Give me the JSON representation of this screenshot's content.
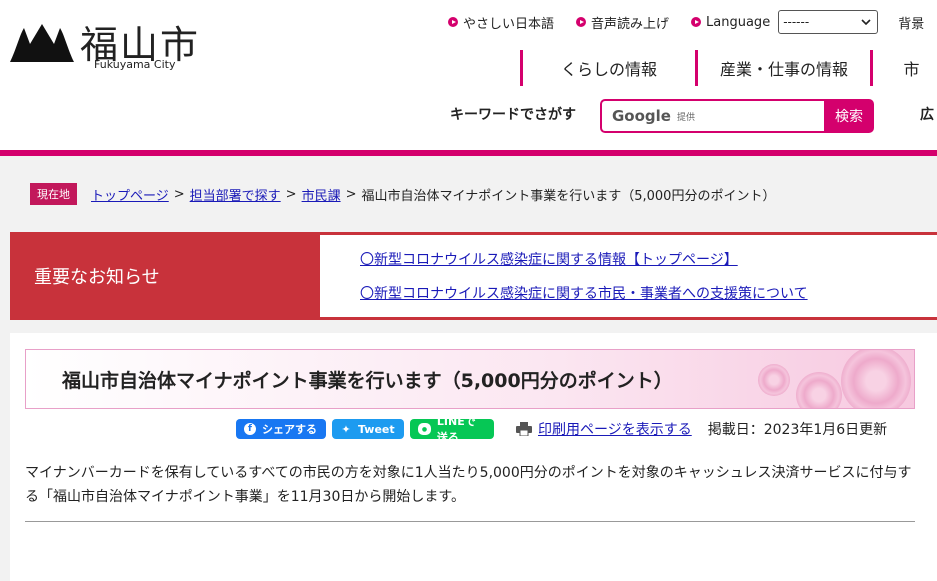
{
  "header": {
    "logo_kanji": "福山市",
    "logo_sub": "Fukuyama City",
    "util": [
      {
        "label": "やさしい日本語"
      },
      {
        "label": "音声読み上げ"
      },
      {
        "label": "Language"
      }
    ],
    "language_select_value": "------",
    "util_cut": "背景",
    "gnav": [
      "くらしの情報",
      "産業・仕事の情報",
      "市"
    ],
    "keyword_label": "キーワードでさがす",
    "search_brand": "Google",
    "search_brand_sub": "提供",
    "search_button": "検索",
    "cut_right": "広"
  },
  "breadcrumb": {
    "here": "現在地",
    "links": [
      "トップページ",
      "担当部署で探す",
      "市民課"
    ],
    "current": "福山市自治体マイナポイント事業を行います（5,000円分のポイント）",
    "separator": ">"
  },
  "notice": {
    "heading": "重要なお知らせ",
    "links": [
      "〇新型コロナウイルス感染症に関する情報【トップページ】",
      "〇新型コロナウイルス感染症に関する市民・事業者への支援策について"
    ]
  },
  "article": {
    "title": "福山市自治体マイナポイント事業を行います（5,000円分のポイント）",
    "share": {
      "facebook": "シェアする",
      "twitter": "Tweet",
      "line": "LINEで送る"
    },
    "print_link": "印刷用ページを表示する",
    "posted": "掲載日：2023年1月6日更新",
    "body": "マイナンバーカードを保有しているすべての市民の方を対象に1人当たり5,000円分のポイントを対象のキャッシュレス決済サービスに付与する「福山市自治体マイナポイント事業」を11月30日から開始します。"
  },
  "colors": {
    "brand_pink": "#d4006d",
    "notice_red": "#c8323b",
    "link_blue": "#1a1ab8"
  }
}
